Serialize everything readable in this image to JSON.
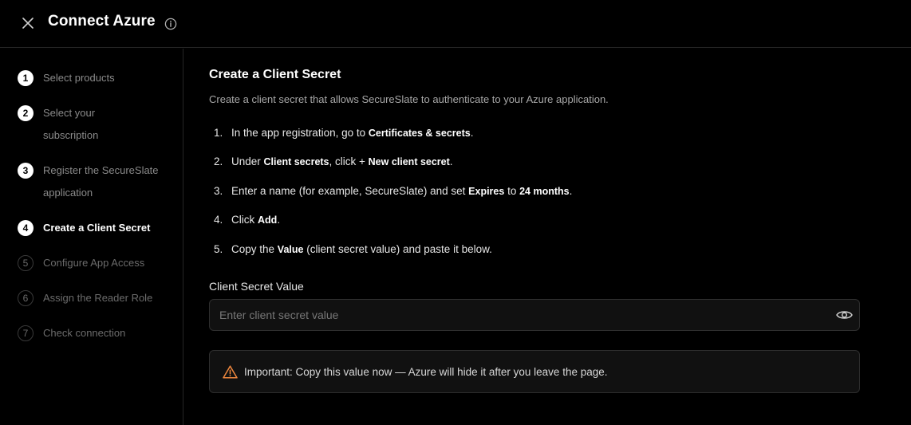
{
  "header": {
    "title": "Connect Azure",
    "close_icon": "close-icon",
    "info_icon": "info-icon"
  },
  "sidebar": {
    "steps": [
      {
        "num": "1",
        "label": "Select products",
        "state": "done"
      },
      {
        "num": "2",
        "label": "Select your subscription",
        "state": "done"
      },
      {
        "num": "3",
        "label": "Register the SecureSlate application",
        "state": "done"
      },
      {
        "num": "4",
        "label": "Create a Client Secret",
        "state": "current"
      },
      {
        "num": "5",
        "label": "Configure App Access",
        "state": "pending"
      },
      {
        "num": "6",
        "label": "Assign the Reader Role",
        "state": "pending"
      },
      {
        "num": "7",
        "label": "Check connection",
        "state": "pending"
      }
    ]
  },
  "main": {
    "title": "Create a Client Secret",
    "description": "Create a client secret that allows SecureSlate to authenticate to your Azure application.",
    "instructions": [
      {
        "num": "1.",
        "parts": [
          "In the app registration, go to ",
          "Certificates & secrets",
          "."
        ]
      },
      {
        "num": "2.",
        "parts": [
          "Under ",
          "Client secrets",
          ", click + ",
          "New client secret",
          "."
        ]
      },
      {
        "num": "3.",
        "parts": [
          "Enter a name (for example, SecureSlate) and set ",
          "Expires",
          " to ",
          "24 months",
          "."
        ]
      },
      {
        "num": "4.",
        "parts": [
          "Click ",
          "Add",
          "."
        ]
      },
      {
        "num": "5.",
        "parts": [
          "Copy the ",
          "Value",
          " (client secret value) and paste it below."
        ]
      }
    ],
    "field": {
      "label": "Client Secret Value",
      "placeholder": "Enter client secret value",
      "value": "",
      "toggle_icon": "eye-icon"
    },
    "alert": {
      "icon": "warning-icon",
      "text": "Important: Copy this value now — Azure will hide it after you leave the page.",
      "icon_color": "#f0883e"
    }
  },
  "colors": {
    "background": "#000000",
    "border": "#262626",
    "text_primary": "#ffffff",
    "text_muted": "#8a8a8a",
    "warning": "#f0883e"
  }
}
